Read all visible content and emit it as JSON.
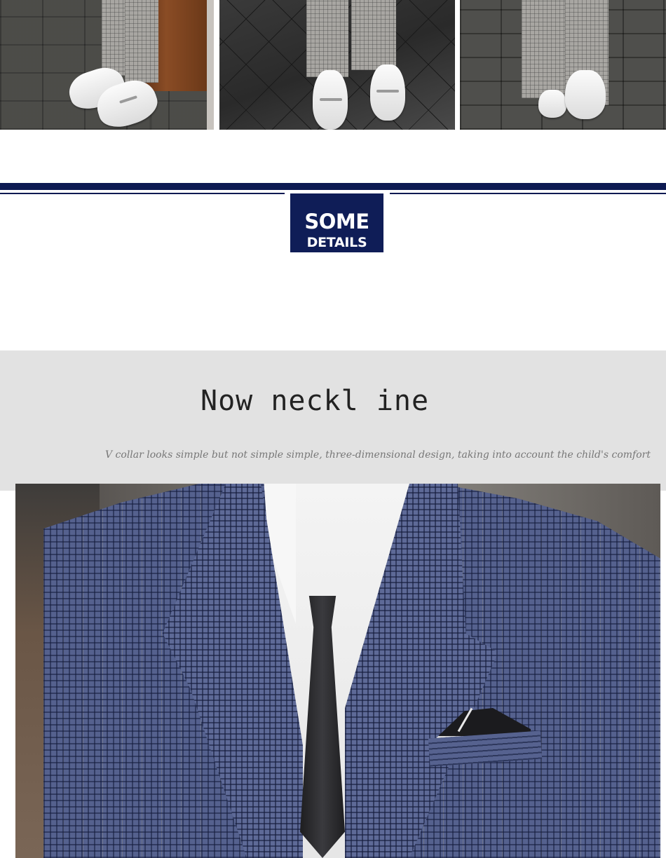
{
  "header": {
    "badge_line1": "SOME",
    "badge_line2": "DETAILS"
  },
  "feature": {
    "title": "Now neckl ine",
    "subtitle": "V collar looks simple but not simple simple, three-dimensional design, taking into account the child's comfort"
  },
  "colors": {
    "navy": "#0d1a52",
    "feature_bg": "#e2e2e2",
    "jacket": "#55618e"
  },
  "images": [
    {
      "name": "loafers-photo-1",
      "description": "plaid trousers with white loafers on gray brick pavement"
    },
    {
      "name": "loafers-photo-2",
      "description": "plaid trousers with white loafers on dark tiled floor"
    },
    {
      "name": "loafers-photo-3",
      "description": "plaid trousers with white loafers, rear view on brick pavement"
    },
    {
      "name": "jacket-neckline-photo",
      "description": "boy wearing navy plaid blazer, white shirt and dark tie"
    }
  ]
}
